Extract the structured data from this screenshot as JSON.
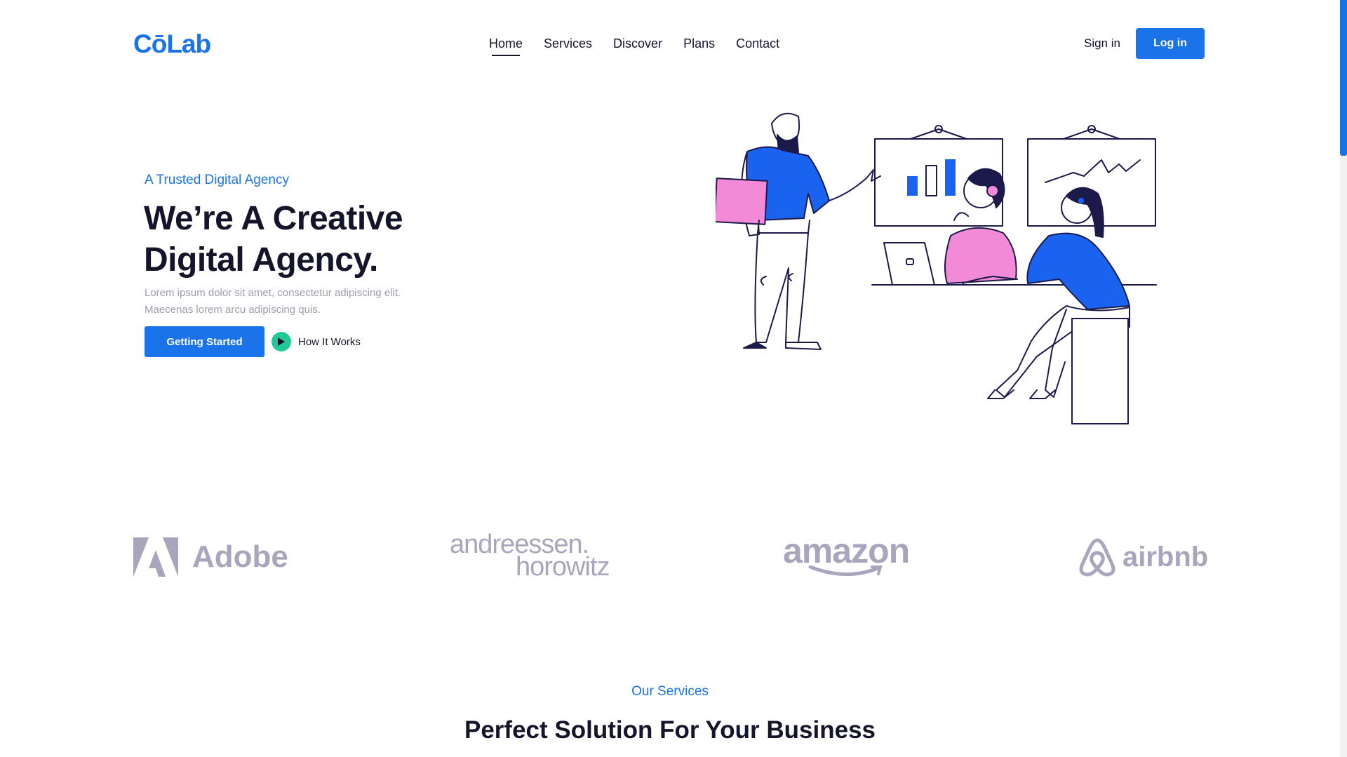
{
  "header": {
    "logo": "CōLab",
    "nav": [
      "Home",
      "Services",
      "Discover",
      "Plans",
      "Contact"
    ],
    "sign_in": "Sign in",
    "log_in": "Log in"
  },
  "hero": {
    "eyebrow": "A Trusted Digital Agency",
    "title_line1": "We’re A Creative",
    "title_line2": "Digital Agency.",
    "desc_line1": "Lorem ipsum dolor sit amet, consectetur adipiscing elit.",
    "desc_line2": "Maecenas lorem arcu adipiscing quis.",
    "cta": "Getting Started",
    "secondary": "How It Works"
  },
  "brands": {
    "adobe": "Adobe",
    "a16z_line1": "andreessen.",
    "a16z_line2": "horowitz",
    "amazon": "amazon",
    "airbnb": "airbnb"
  },
  "services": {
    "eyebrow": "Our Services",
    "title": "Perfect Solution For Your Business"
  },
  "colors": {
    "accent": "#1a73e8",
    "play": "#20c997",
    "text": "#14142b",
    "muted": "#9e9eab",
    "brand_gray": "#a7a6bc",
    "illustration_pink": "#f28ad8"
  }
}
